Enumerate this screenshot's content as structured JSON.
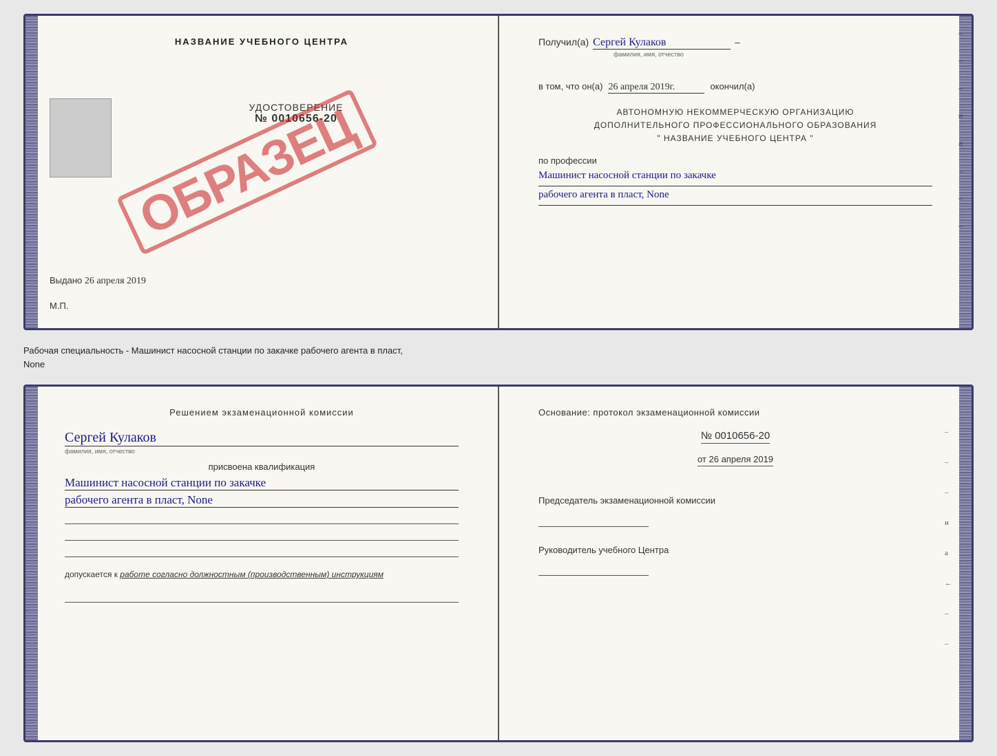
{
  "top_doc": {
    "left": {
      "title": "НАЗВАНИЕ УЧЕБНОГО ЦЕНТРА",
      "udostoverenie_label": "УДОСТОВЕРЕНИЕ",
      "number": "№ 0010656-20",
      "vydano_label": "Выдано",
      "vydano_date": "26 апреля 2019",
      "mp_label": "М.П.",
      "obrazets": "ОБРАЗЕЦ"
    },
    "right": {
      "poluchil_label": "Получил(а)",
      "poluchil_name": "Сергей Кулаков",
      "familiya_hint": "фамилия, имя, отчество",
      "dash": "–",
      "vtom_label": "в том, что он(а)",
      "vtom_date": "26 апреля 2019г.",
      "okonchil_label": "окончил(а)",
      "avtonom1": "АВТОНОМНУЮ НЕКОММЕРЧЕСКУЮ ОРГАНИЗАЦИЮ",
      "avtonom2": "ДОПОЛНИТЕЛЬНОГО ПРОФЕССИОНАЛЬНОГО ОБРАЗОВАНИЯ",
      "avtonom3": "\"  НАЗВАНИЕ УЧЕБНОГО ЦЕНТРА  \"",
      "po_professii": "по профессии",
      "profession_line1": "Машинист насосной станции по закачке",
      "profession_line2": "рабочего агента в пласт, None",
      "markers": [
        "-",
        "-",
        "-",
        "и",
        "а",
        "←",
        "-",
        "-",
        "-"
      ]
    }
  },
  "separator": {
    "text": "Рабочая специальность - Машинист насосной станции по закачке рабочего агента в пласт,",
    "text2": "None"
  },
  "bottom_doc": {
    "left": {
      "resheniem_title": "Решением экзаменационной комиссии",
      "name": "Сергей Кулаков",
      "familiya_hint": "фамилия, имя, отчество",
      "prisvoena": "присвоена квалификация",
      "kvalif_line1": "Машинист насосной станции по закачке",
      "kvalif_line2": "рабочего агента в пласт, None",
      "blank_lines": [
        "",
        "",
        ""
      ],
      "dopuskaetsya": "допускается к",
      "dopusk_text": "работе согласно должностным (производственным) инструкциям",
      "bottom_line": ""
    },
    "right": {
      "osnovanie_title": "Основание: протокол экзаменационной комиссии",
      "number_label": "№ 0010656-20",
      "ot_label": "от",
      "ot_date": "26 апреля 2019",
      "predsedatel_title": "Председатель экзаменационной комиссии",
      "rukovoditel_title": "Руководитель учебного Центра",
      "markers": [
        "-",
        "-",
        "-",
        "и",
        "а",
        "←",
        "-",
        "-",
        "-"
      ]
    }
  }
}
